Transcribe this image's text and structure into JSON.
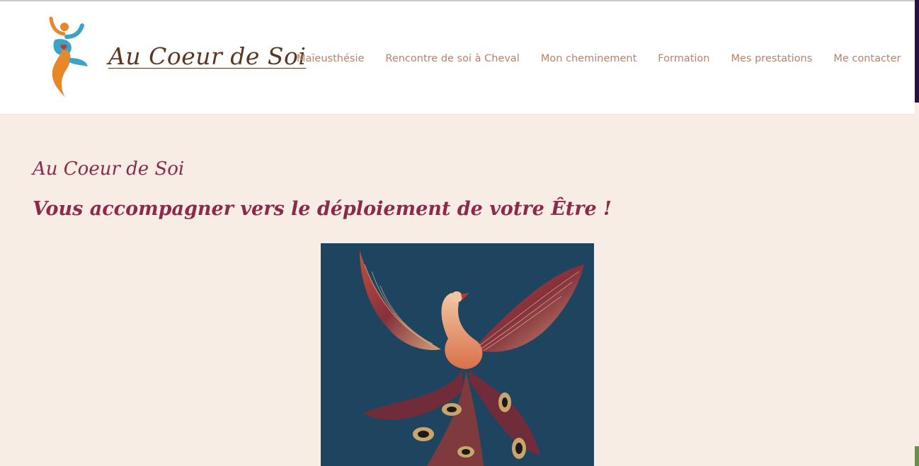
{
  "site": {
    "title": "Au Coeur de Soi"
  },
  "nav": {
    "items": [
      {
        "label": "Maïeusthésie"
      },
      {
        "label": "Rencontre de soi à Cheval"
      },
      {
        "label": "Mon cheminement"
      },
      {
        "label": "Formation"
      },
      {
        "label": "Mes prestations"
      },
      {
        "label": "Me contacter"
      }
    ]
  },
  "main": {
    "heading": "Au Coeur de Soi",
    "tagline": "Vous accompagner vers le déploiement de votre Être !"
  },
  "colors": {
    "background": "#f7ede4",
    "header_bg": "#ffffff",
    "nav_text": "#b8826b",
    "heading": "#8d2a4c",
    "site_title": "#5b3722",
    "art_bg": "#1f4460"
  }
}
